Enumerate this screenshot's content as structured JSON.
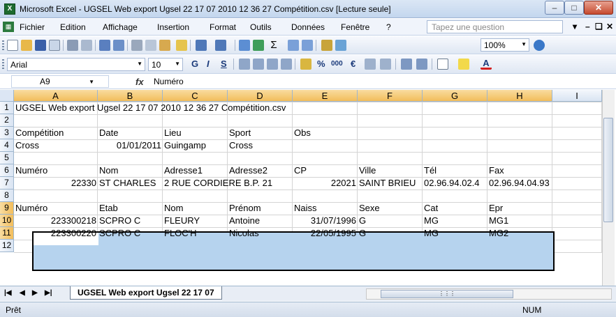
{
  "window": {
    "title": "Microsoft Excel - UGSEL Web export Ugsel 22 17 07 2010 12 36 27 Compétition.csv  [Lecture seule]",
    "app_icon_label": "X"
  },
  "menu": {
    "items": [
      "Fichier",
      "Edition",
      "Affichage",
      "Insertion",
      "Format",
      "Outils",
      "Données",
      "Fenêtre",
      "?"
    ],
    "ask_placeholder": "Tapez une question"
  },
  "toolbar": {
    "zoom": "100%",
    "font_name": "Arial",
    "font_size": "10",
    "bold": "G",
    "italic": "I",
    "underline": "S",
    "percent": "%",
    "thousands": "000",
    "euro": "€"
  },
  "formula_bar": {
    "cell_ref": "A9",
    "fx": "fx",
    "value": "Numéro"
  },
  "grid": {
    "columns": [
      "A",
      "B",
      "C",
      "D",
      "E",
      "F",
      "G",
      "H",
      "I"
    ],
    "rows": [
      "1",
      "2",
      "3",
      "4",
      "5",
      "6",
      "7",
      "8",
      "9",
      "10",
      "11",
      "12"
    ],
    "cells": {
      "r1": {
        "A": "UGSEL Web export Ugsel 22 17 07 2010 12 36 27 Compétition.csv"
      },
      "r3": {
        "A": "Compétition",
        "B": "Date",
        "C": "Lieu",
        "D": "Sport",
        "E": "Obs"
      },
      "r4": {
        "A": "Cross",
        "B": "01/01/2011",
        "C": "Guingamp",
        "D": "Cross"
      },
      "r6": {
        "A": "Numéro",
        "B": "Nom",
        "C": "Adresse1",
        "D": "Adresse2",
        "E": "CP",
        "F": "Ville",
        "G": "Tél",
        "H": "Fax"
      },
      "r7": {
        "A": "22330",
        "B": "ST CHARLES",
        "C": "2 RUE CORDIERE B.P. 21",
        "E": "22021",
        "F": "SAINT BRIEU",
        "G": "02.96.94.02.4",
        "H": "02.96.94.04.93"
      },
      "r9": {
        "A": "Numéro",
        "B": "Etab",
        "C": "Nom",
        "D": "Prénom",
        "E": "Naiss",
        "F": "Sexe",
        "G": "Cat",
        "H": "Epr"
      },
      "r10": {
        "A": "223300218",
        "B": "SCPRO C",
        "C": "FLEURY",
        "D": "Antoine",
        "E": "31/07/1996",
        "F": "G",
        "G": "MG",
        "H": "MG1"
      },
      "r11": {
        "A": "223300220",
        "B": "SCPRO C",
        "C": "FLOC'H",
        "D": "Nicolas",
        "E": "22/05/1995",
        "F": "G",
        "G": "MG",
        "H": "MG2"
      }
    }
  },
  "sheet_tabs": {
    "active": "UGSEL Web export Ugsel 22 17 07"
  },
  "status": {
    "text": "Prêt",
    "num": "NUM"
  }
}
